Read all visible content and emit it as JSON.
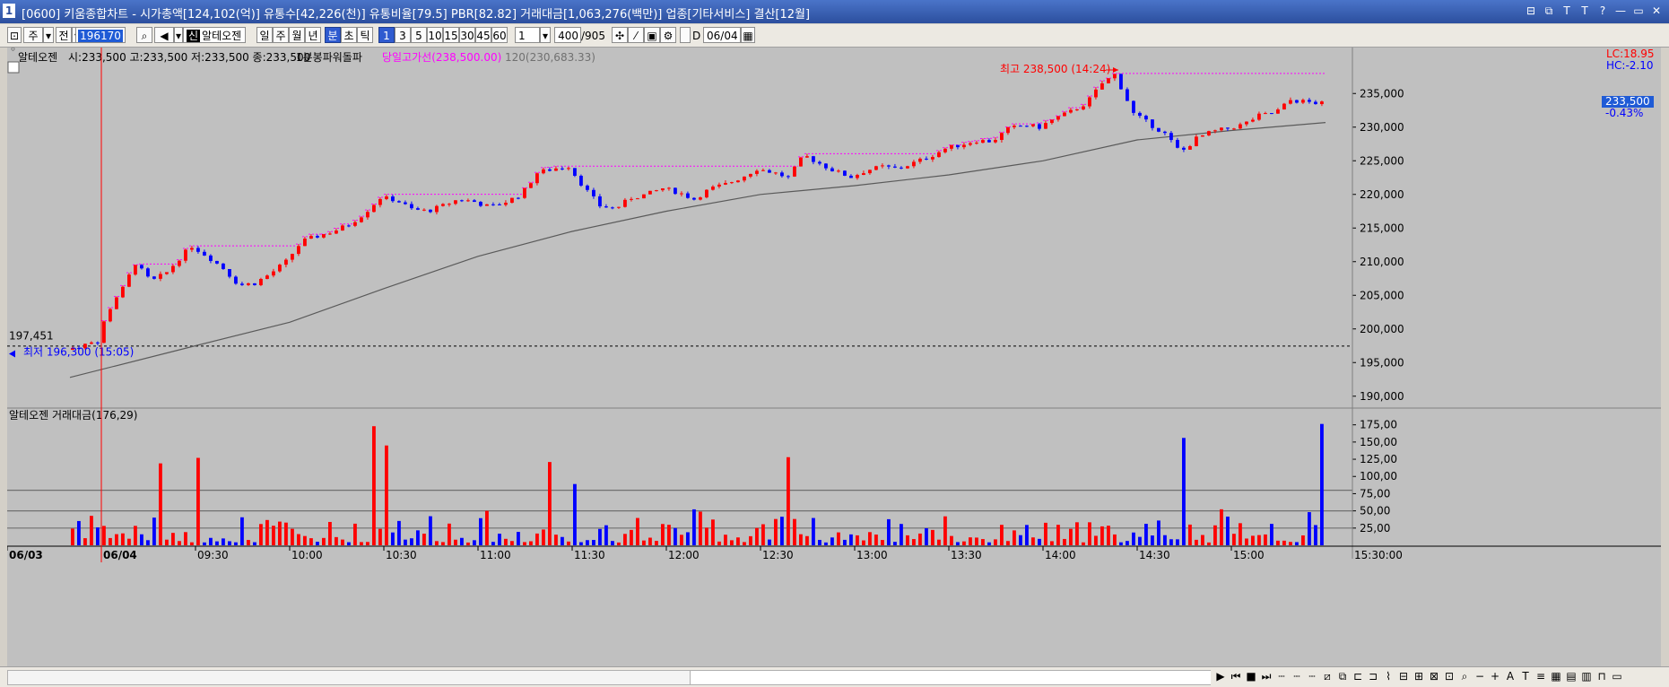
{
  "window": {
    "number": "1",
    "title": "[0600] 키움종합차트 - 시가총액[124,102(억)] 유통수[42,226(천)] 유통비율[79.5] PBR[82.82] 거래대금[1,063,276(백만)] 업종[기타서비스] 결산[12월]",
    "buttons": [
      "⊟",
      "⧉",
      "T",
      "T",
      "?",
      "—",
      "▭",
      "✕"
    ]
  },
  "toolbar": {
    "period_type": "주",
    "all_label": "전",
    "code": "196170",
    "stock_name": "알테오젠",
    "period_tabs": [
      "일",
      "주",
      "월",
      "년",
      "분",
      "초",
      "틱"
    ],
    "selected_period": "분",
    "minute_tabs": [
      "1",
      "3",
      "5",
      "10",
      "15",
      "30",
      "45",
      "60"
    ],
    "selected_minute": "1",
    "interval_value": "1",
    "count_value": "400",
    "count_total": "/905",
    "date_label": "D",
    "date_value": "06/04"
  },
  "price_pane": {
    "legend": {
      "stock": "알테오젠",
      "ohlc": "시:233,500 고:233,500 저:233,500 종:233,500",
      "indicator1": "1분봉파워돌파",
      "indicator2": "당일고가선(238,500.00)",
      "indicator3": "120(230,683.33)"
    },
    "lc_label": "LC:18.95",
    "hc_label": "HC:-2.10",
    "current_price": "233,500",
    "current_change": "-0.43%",
    "high_annotation": "최고 238,500 (14:24)",
    "low_annotation": "최저 196,300 (15:05)",
    "prev_close_label": "197,451"
  },
  "volume_pane": {
    "legend": "알테오젠 거래대금(176,29)"
  },
  "colors": {
    "background": "#c0c0c0",
    "up": "#ff0000",
    "down": "#0000ff",
    "ma120": "#5a5a5a",
    "day_high_line": "#ff00ff",
    "accent": "#2f5bd0"
  },
  "chart_data": [
    {
      "type": "candlestick",
      "title": "",
      "y_axis_ticks": [
        "235,000",
        "230,000",
        "225,000",
        "220,000",
        "215,000",
        "210,000",
        "205,000",
        "200,000",
        "195,000",
        "190,000"
      ],
      "ylim": [
        188500,
        240500
      ],
      "x_axis_ticks": [
        "06/03",
        "06/04",
        "09:30",
        "10:00",
        "10:30",
        "11:00",
        "11:30",
        "12:00",
        "12:30",
        "13:00",
        "13:30",
        "14:00",
        "14:30",
        "15:00",
        "15:30:00"
      ],
      "x_range": [
        "08:50",
        "15:30"
      ],
      "close_path": [
        [
          "08:50",
          196900
        ],
        [
          "09:00",
          198200
        ],
        [
          "09:02",
          201000
        ],
        [
          "09:05",
          204200
        ],
        [
          "09:08",
          206000
        ],
        [
          "09:12",
          209800
        ],
        [
          "09:17",
          207000
        ],
        [
          "09:22",
          208400
        ],
        [
          "09:27",
          211000
        ],
        [
          "09:30",
          212300
        ],
        [
          "09:35",
          210800
        ],
        [
          "09:40",
          209000
        ],
        [
          "09:45",
          206500
        ],
        [
          "09:50",
          206800
        ],
        [
          "09:55",
          208200
        ],
        [
          "10:00",
          210000
        ],
        [
          "10:05",
          213000
        ],
        [
          "10:10",
          213800
        ],
        [
          "10:15",
          214500
        ],
        [
          "10:20",
          215500
        ],
        [
          "10:25",
          217200
        ],
        [
          "10:30",
          219500
        ],
        [
          "10:35",
          219200
        ],
        [
          "10:40",
          217800
        ],
        [
          "10:45",
          217500
        ],
        [
          "10:50",
          218300
        ],
        [
          "10:55",
          219300
        ],
        [
          "11:00",
          218900
        ],
        [
          "11:05",
          218100
        ],
        [
          "11:10",
          218900
        ],
        [
          "11:15",
          220000
        ],
        [
          "11:20",
          223200
        ],
        [
          "11:25",
          223800
        ],
        [
          "11:30",
          224200
        ],
        [
          "11:35",
          221000
        ],
        [
          "11:40",
          218300
        ],
        [
          "11:45",
          217900
        ],
        [
          "11:50",
          219500
        ],
        [
          "11:55",
          220000
        ],
        [
          "12:00",
          220900
        ],
        [
          "12:05",
          220300
        ],
        [
          "12:10",
          219300
        ],
        [
          "12:15",
          220800
        ],
        [
          "12:20",
          221500
        ],
        [
          "12:25",
          222500
        ],
        [
          "12:30",
          223800
        ],
        [
          "12:35",
          223300
        ],
        [
          "12:40",
          222500
        ],
        [
          "12:45",
          225800
        ],
        [
          "12:50",
          224600
        ],
        [
          "12:55",
          223400
        ],
        [
          "13:00",
          222600
        ],
        [
          "13:05",
          223600
        ],
        [
          "13:10",
          224100
        ],
        [
          "13:15",
          223800
        ],
        [
          "13:20",
          224700
        ],
        [
          "13:25",
          225600
        ],
        [
          "13:30",
          226800
        ],
        [
          "13:35",
          227400
        ],
        [
          "13:40",
          228000
        ],
        [
          "13:45",
          227900
        ],
        [
          "13:50",
          229700
        ],
        [
          "13:55",
          230300
        ],
        [
          "14:00",
          230000
        ],
        [
          "14:05",
          231300
        ],
        [
          "14:10",
          232300
        ],
        [
          "14:15",
          233600
        ],
        [
          "14:20",
          236500
        ],
        [
          "14:24",
          237800
        ],
        [
          "14:27",
          235000
        ],
        [
          "14:30",
          232000
        ],
        [
          "14:35",
          230500
        ],
        [
          "14:40",
          229000
        ],
        [
          "14:45",
          226200
        ],
        [
          "14:50",
          228300
        ],
        [
          "14:55",
          229300
        ],
        [
          "15:00",
          229800
        ],
        [
          "15:05",
          230400
        ],
        [
          "15:10",
          231700
        ],
        [
          "15:15",
          232100
        ],
        [
          "15:20",
          234000
        ],
        [
          "15:30",
          233500
        ]
      ],
      "day_high": 238500,
      "day_low": 196300,
      "prev_close": 197451,
      "ma120_path": [
        [
          "08:50",
          192800
        ],
        [
          "09:30",
          197500
        ],
        [
          "10:00",
          201000
        ],
        [
          "10:30",
          206000
        ],
        [
          "11:00",
          210800
        ],
        [
          "11:30",
          214500
        ],
        [
          "12:00",
          217500
        ],
        [
          "12:30",
          220000
        ],
        [
          "13:00",
          221300
        ],
        [
          "13:30",
          222900
        ],
        [
          "14:00",
          225000
        ],
        [
          "14:30",
          228100
        ],
        [
          "15:00",
          229500
        ],
        [
          "15:30",
          230683.33
        ]
      ]
    },
    {
      "type": "bar",
      "title": "",
      "y_axis_ticks": [
        "175,00",
        "150,00",
        "125,00",
        "100,00",
        "75,00",
        "50,00",
        "25,00"
      ],
      "ylim": [
        0,
        185
      ],
      "reference_lines": [
        80,
        50,
        25
      ],
      "notable_bars": [
        [
          "09:18",
          119,
          "up"
        ],
        [
          "09:31",
          127,
          "up"
        ],
        [
          "10:27",
          173,
          "up"
        ],
        [
          "10:31",
          145,
          "up"
        ],
        [
          "11:22",
          121,
          "up"
        ],
        [
          "11:31",
          89,
          "down"
        ],
        [
          "12:38",
          128,
          "up"
        ],
        [
          "14:44",
          156,
          "down"
        ],
        [
          "15:29",
          176.29,
          "down"
        ]
      ]
    }
  ]
}
